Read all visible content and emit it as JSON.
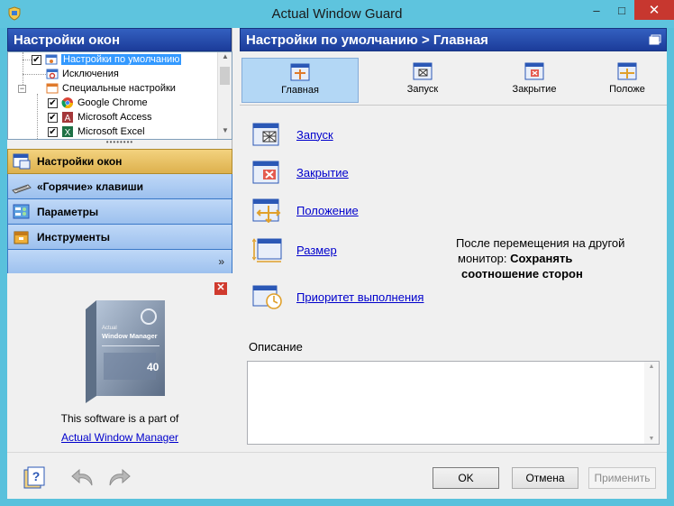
{
  "window": {
    "title": "Actual Window Guard",
    "controls": {
      "minimize": "–",
      "maximize": "□",
      "close": "✕"
    }
  },
  "left": {
    "header": "Настройки окон",
    "tree": [
      {
        "label": "Настройки по умолчанию",
        "checked": true,
        "selected": true,
        "icon": "default-settings-icon"
      },
      {
        "label": "Исключения",
        "checked": false,
        "icon": "exclusions-icon"
      },
      {
        "label": "Специальные настройки",
        "checked": false,
        "icon": "special-settings-icon"
      },
      {
        "label": "Google Chrome",
        "checked": true,
        "icon": "chrome-icon"
      },
      {
        "label": "Microsoft Access",
        "checked": true,
        "icon": "access-icon"
      },
      {
        "label": "Microsoft Excel",
        "checked": true,
        "icon": "excel-icon"
      }
    ],
    "nav": [
      {
        "label": "Настройки окон",
        "icon": "window-settings-icon"
      },
      {
        "label": "«Горячие» клавиши",
        "icon": "keyboard-icon"
      },
      {
        "label": "Параметры",
        "icon": "parameters-icon"
      },
      {
        "label": "Инструменты",
        "icon": "tools-icon"
      }
    ],
    "nav_more": "»",
    "promo": {
      "caption": "This software is a part of",
      "link": "Actual Window Manager",
      "box_brand": "Actual",
      "box_title": "Window Manager"
    }
  },
  "right": {
    "header": "Настройки по умолчанию > Главная",
    "tabs": [
      {
        "label": "Главная",
        "icon": "main-tab-icon"
      },
      {
        "label": "Запуск",
        "icon": "startup-tab-icon"
      },
      {
        "label": "Закрытие",
        "icon": "close-tab-icon"
      },
      {
        "label": "Положе",
        "icon": "position-tab-icon"
      }
    ],
    "actions": [
      {
        "label": "Запуск",
        "icon": "startup-icon"
      },
      {
        "label": "Закрытие",
        "icon": "closing-icon"
      },
      {
        "label": "Положение",
        "icon": "position-icon"
      },
      {
        "label": "Размер",
        "icon": "size-icon"
      },
      {
        "label": "Приоритет выполнения",
        "icon": "priority-icon"
      }
    ],
    "resize_note": {
      "line1": "После перемещения на другой",
      "prefix": "монитор: ",
      "bold1": "Сохранять",
      "bold2": "соотношение сторон"
    },
    "description_label": "Описание",
    "description_value": ""
  },
  "bottom": {
    "ok": "OK",
    "cancel": "Отмена",
    "apply": "Применить"
  },
  "colors": {
    "titlebar": "#5ec4de",
    "header_blue": "#1c3c9a",
    "nav_active": "#ddb14d",
    "nav_normal": "#9cc0ee",
    "close_red": "#c7372f",
    "link_blue": "#0000cc",
    "selection": "#3399ff"
  }
}
